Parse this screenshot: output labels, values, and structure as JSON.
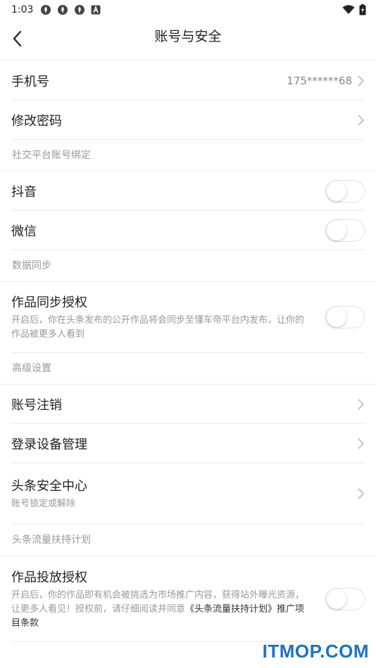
{
  "status_bar": {
    "time": "1:03",
    "notification_icons": [
      "notification-icon",
      "notification-icon",
      "notification-icon",
      "a-icon"
    ],
    "right_icons": [
      "wifi-icon",
      "battery-icon"
    ]
  },
  "nav": {
    "title": "账号与安全",
    "back_icon": "chevron-left-icon"
  },
  "phone": {
    "label": "手机号",
    "value": "175******68"
  },
  "password": {
    "label": "修改密码"
  },
  "social": {
    "section": "社交平台账号绑定",
    "items": [
      {
        "label": "抖音",
        "on": false
      },
      {
        "label": "微信",
        "on": false
      }
    ]
  },
  "sync": {
    "section": "数据同步",
    "label": "作品同步授权",
    "desc": "开启后，你在头条发布的公开作品将会同步至懂车帝平台内发布，让你的作品被更多人看到",
    "on": false
  },
  "advanced": {
    "section": "高级设置",
    "cancel": {
      "label": "账号注销"
    },
    "devices": {
      "label": "登录设备管理"
    },
    "security": {
      "label": "头条安全中心",
      "desc": "账号锁定或解除"
    }
  },
  "traffic": {
    "section": "头条流量扶持计划",
    "label": "作品投放授权",
    "desc": "开启后，你的作品即有机会被挑选为市场推广内容，获得站外曝光资源，让更多人看见！授权前，请仔细阅读并同意",
    "desc_link": "《头条流量扶持计划》推广项目条款",
    "on": false
  },
  "watermark": "ITMOP.COM",
  "colors": {
    "divider": "#ececec",
    "secondary_text": "#999999",
    "watermark": "#1a73c9"
  }
}
